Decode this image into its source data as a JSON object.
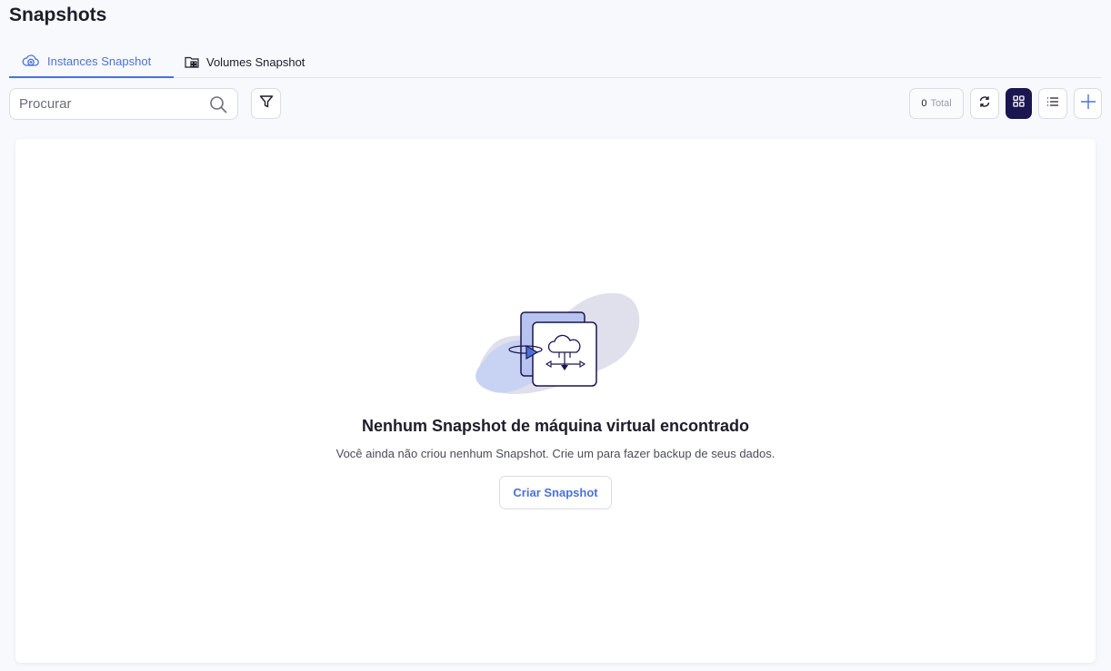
{
  "page": {
    "title": "Snapshots"
  },
  "tabs": [
    {
      "label": "Instances Snapshot",
      "icon": "cloud-plus-icon",
      "active": true
    },
    {
      "label": "Volumes Snapshot",
      "icon": "folder-grid-icon",
      "active": false
    }
  ],
  "toolbar": {
    "search_placeholder": "Procurar",
    "total_count": "0",
    "total_label": "Total",
    "accent_color": "#4a72d6",
    "active_view_color": "#1b1550"
  },
  "empty_state": {
    "title": "Nenhum Snapshot de máquina virtual encontrado",
    "subtitle": "Você ainda não criou nenhum Snapshot. Crie um para fazer backup de seus dados.",
    "button_label": "Criar Snapshot"
  }
}
